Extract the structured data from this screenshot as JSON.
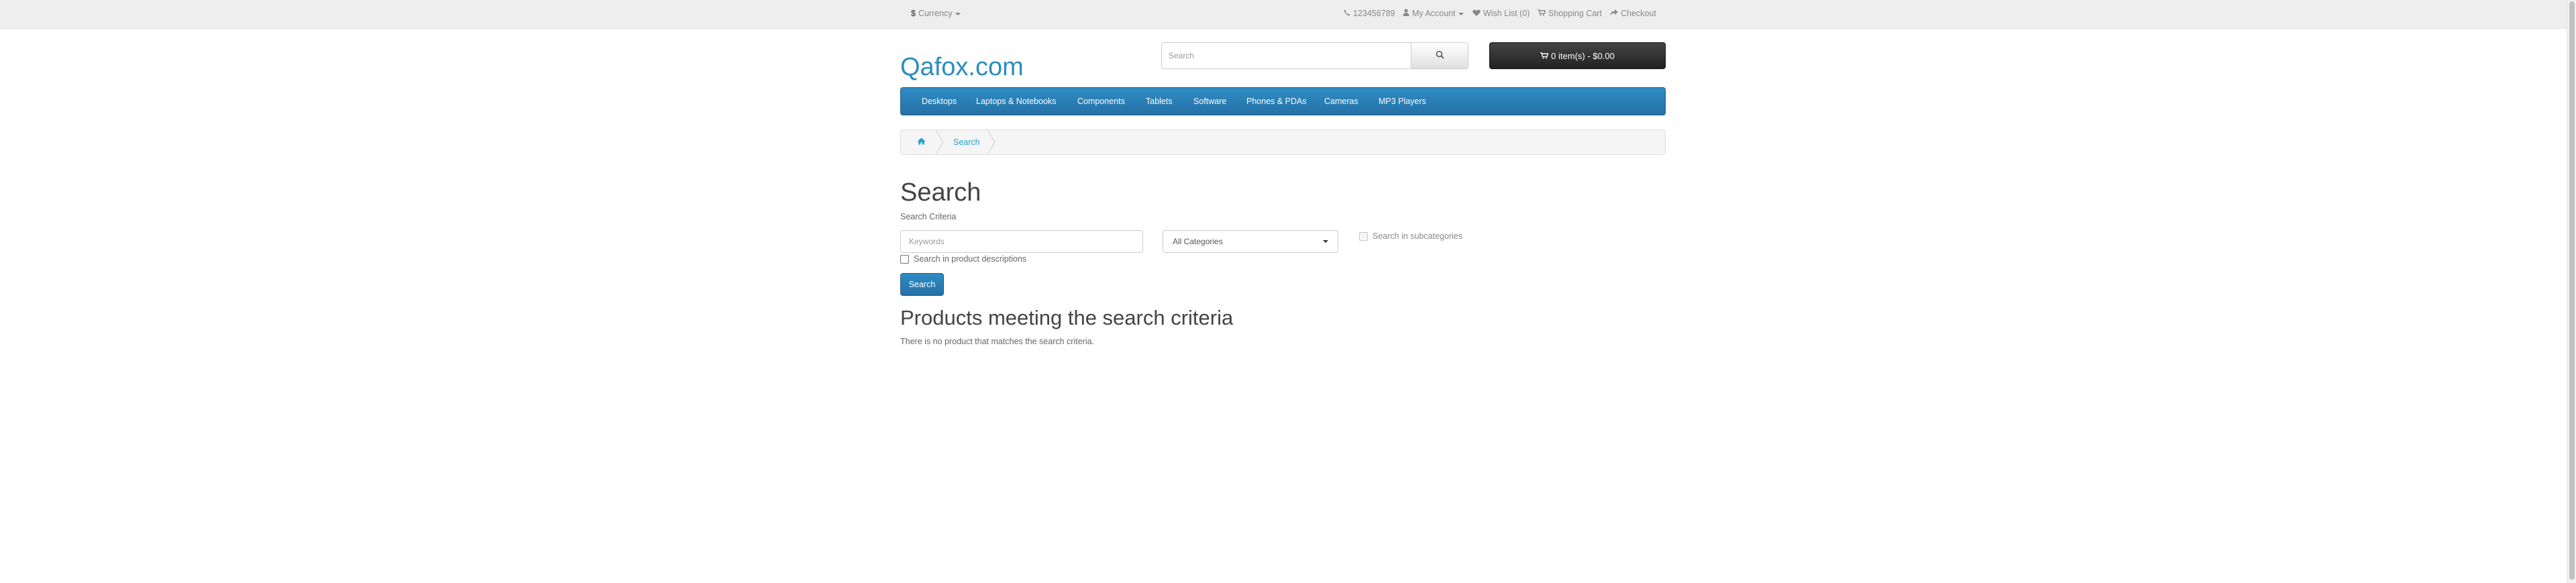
{
  "topbar": {
    "currency_symbol": "$",
    "currency_label": "Currency",
    "phone": "123456789",
    "account_label": "My Account",
    "wishlist_label": "Wish List (0)",
    "cart_label": "Shopping Cart",
    "checkout_label": "Checkout"
  },
  "header": {
    "logo": "Qafox.com",
    "search_placeholder": "Search",
    "cart_button": "0 item(s) - $0.00"
  },
  "menu": {
    "items": [
      "Desktops",
      "Laptops & Notebooks",
      "Components",
      "Tablets",
      "Software",
      "Phones & PDAs",
      "Cameras",
      "MP3 Players"
    ]
  },
  "breadcrumb": {
    "current": "Search"
  },
  "content": {
    "title": "Search",
    "criteria_label": "Search Criteria",
    "keywords_placeholder": "Keywords",
    "category_selected": "All Categories",
    "subcategories_label": "Search in subcategories",
    "descriptions_label": "Search in product descriptions",
    "search_button": "Search",
    "results_title": "Products meeting the search criteria",
    "no_results": "There is no product that matches the search criteria."
  },
  "colors": {
    "accent": "#2b8dbd",
    "menu_bg": "#2a7fb7",
    "cart_button_bg": "#333333",
    "link": "#23a1d1"
  }
}
